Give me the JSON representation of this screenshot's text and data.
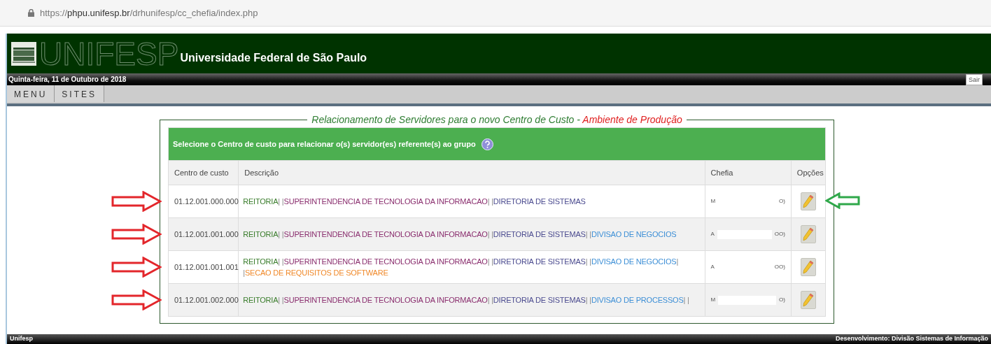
{
  "browser": {
    "url": {
      "scheme": "https://",
      "host": "phpu.unifesp.br",
      "path": "/drhunifesp/cc_chefia/index.php"
    }
  },
  "header": {
    "wordmark": "UNIFESP",
    "title": "Universidade Federal de São Paulo"
  },
  "date_bar": {
    "date": "Quinta-feira, 11 de Outubro de 2018",
    "logout": "Sair"
  },
  "menu": [
    {
      "label": "MENU"
    },
    {
      "label": "SITES"
    }
  ],
  "panel": {
    "legend": {
      "text": "Relacionamento de Servidores para o novo Centro de Custo - ",
      "highlight": "Ambiente de Produção"
    },
    "instruction": "Selecione o Centro de custo para relacionar o(s) servidor(es) referente(s) ao grupo",
    "columns": [
      "Centro de custo",
      "Descrição",
      "Chefia",
      "Opções"
    ],
    "rows": [
      {
        "code": "01.12.001.000.000",
        "description": [
          {
            "kind": "unit",
            "text": "REITORIA",
            "color": "#3a7d2c"
          },
          {
            "kind": "separator",
            "text": "| |"
          },
          {
            "kind": "unit",
            "text": "SUPERINTENDENCIA DE TECNOLOGIA DA INFORMACAO",
            "color": "#8a2e6e"
          },
          {
            "kind": "separator",
            "text": "| |"
          },
          {
            "kind": "unit",
            "text": "DIRETORIA DE SISTEMAS",
            "color": "#4b4b8f"
          }
        ],
        "chefia": {
          "start": "M",
          "end": "O)"
        },
        "arrows": [
          {
            "kind": "left",
            "color": "#e3262b"
          },
          {
            "kind": "right",
            "color": "#2fa84a"
          }
        ]
      },
      {
        "code": "01.12.001.001.000",
        "description": [
          {
            "kind": "unit",
            "text": "REITORIA",
            "color": "#3a7d2c"
          },
          {
            "kind": "separator",
            "text": "| |"
          },
          {
            "kind": "unit",
            "text": "SUPERINTENDENCIA DE TECNOLOGIA DA INFORMACAO",
            "color": "#8a2e6e"
          },
          {
            "kind": "separator",
            "text": "| |"
          },
          {
            "kind": "unit",
            "text": "DIRETORIA DE SISTEMAS",
            "color": "#4b4b8f"
          },
          {
            "kind": "separator",
            "text": "| |"
          },
          {
            "kind": "unit",
            "text": "DIVISAO DE NEGOCIOS",
            "color": "#3d8fd6"
          }
        ],
        "chefia": {
          "start": "A",
          "end": "OO)"
        },
        "arrows": [
          {
            "kind": "left",
            "color": "#e3262b"
          }
        ]
      },
      {
        "code": "01.12.001.001.001",
        "description": [
          {
            "kind": "unit",
            "text": "REITORIA",
            "color": "#3a7d2c"
          },
          {
            "kind": "separator",
            "text": "| |"
          },
          {
            "kind": "unit",
            "text": "SUPERINTENDENCIA DE TECNOLOGIA DA INFORMACAO",
            "color": "#8a2e6e"
          },
          {
            "kind": "separator",
            "text": "| |"
          },
          {
            "kind": "unit",
            "text": "DIRETORIA DE SISTEMAS",
            "color": "#4b4b8f"
          },
          {
            "kind": "separator",
            "text": "| |"
          },
          {
            "kind": "unit",
            "text": "DIVISAO DE NEGOCIOS",
            "color": "#3d8fd6"
          },
          {
            "kind": "separator",
            "text": "| |"
          },
          {
            "kind": "unit",
            "text": "SECAO DE REQUISITOS DE SOFTWARE",
            "color": "#f0892a"
          }
        ],
        "chefia": {
          "start": "A",
          "end": "OO)"
        },
        "arrows": [
          {
            "kind": "left",
            "color": "#e3262b"
          }
        ]
      },
      {
        "code": "01.12.001.002.000",
        "description": [
          {
            "kind": "unit",
            "text": "REITORIA",
            "color": "#3a7d2c"
          },
          {
            "kind": "separator",
            "text": "| |"
          },
          {
            "kind": "unit",
            "text": "SUPERINTENDENCIA DE TECNOLOGIA DA INFORMACAO",
            "color": "#8a2e6e"
          },
          {
            "kind": "separator",
            "text": "| |"
          },
          {
            "kind": "unit",
            "text": "DIRETORIA DE SISTEMAS",
            "color": "#4b4b8f"
          },
          {
            "kind": "separator",
            "text": "| |"
          },
          {
            "kind": "unit",
            "text": "DIVISAO DE PROCESSOS",
            "color": "#3d8fd6"
          },
          {
            "kind": "separator",
            "text": "| |"
          }
        ],
        "chefia": {
          "start": "M",
          "end": "O)"
        },
        "arrows": [
          {
            "kind": "left",
            "color": "#e3262b"
          }
        ]
      }
    ]
  },
  "footer": {
    "left": "Unifesp",
    "right": "Desenvolvimento: Divisão Sistemas de Informação"
  }
}
